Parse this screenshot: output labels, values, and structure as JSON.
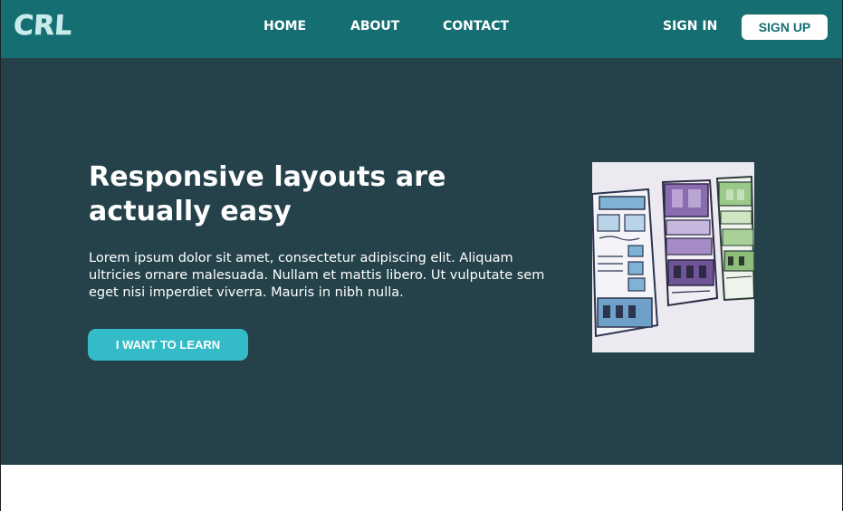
{
  "header": {
    "logo": "CRL",
    "nav": {
      "home": "HOME",
      "about": "ABOUT",
      "contact": "CONTACT"
    },
    "sign_in": "SIGN IN",
    "sign_up": "SIGN UP"
  },
  "hero": {
    "title": "Responsive layouts are actually easy",
    "body": "Lorem ipsum dolor sit amet, consectetur adipiscing elit. Aliquam ultricies ornare malesuada. Nullam et mattis libero. Ut vulputate sem eget nisi imperdiet viverra. Mauris in nibh nulla.",
    "cta": "I WANT TO LEARN",
    "image_icon": "wireframe-sketch-image"
  },
  "colors": {
    "navbar": "#156e72",
    "hero_background": "#25424b",
    "accent": "#33bcc8",
    "logo": "#c9ebec",
    "white": "#ffffff"
  }
}
